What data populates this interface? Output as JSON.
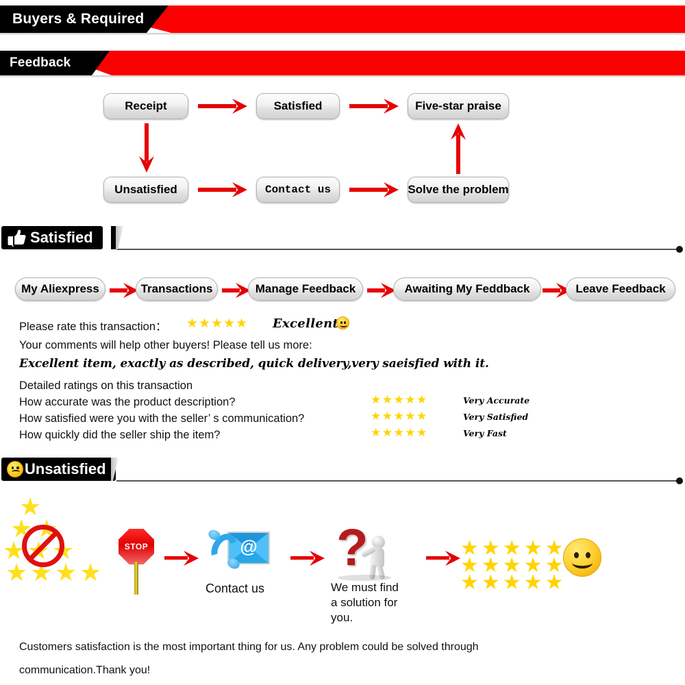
{
  "banners": [
    {
      "id": "buyers",
      "label": "Buyers & Required"
    },
    {
      "id": "feedback",
      "label": "Feedback"
    }
  ],
  "flowchart": {
    "nodes": [
      {
        "id": "receipt",
        "label": "Receipt"
      },
      {
        "id": "satisfied",
        "label": "Satisfied"
      },
      {
        "id": "five-star-praise",
        "label": "Five-star praise"
      },
      {
        "id": "unsatisfied",
        "label": "Unsatisfied"
      },
      {
        "id": "contact-us",
        "label": "Contact us"
      },
      {
        "id": "solve-the-problem",
        "label": "Solve the problem"
      }
    ]
  },
  "satisfied_section": {
    "title": "Satisfied",
    "icon": "thumbs-up-icon",
    "breadcrumbs": [
      {
        "label": "My Aliexpress"
      },
      {
        "label": "Transactions"
      },
      {
        "label": "Manage Feedback"
      },
      {
        "label": "Awaiting My Feddback"
      },
      {
        "label": "Leave Feedback"
      }
    ],
    "rate_prompt": "Please rate this transaction：",
    "rate_stars": "★★★★★",
    "rate_word": "Excellent",
    "rate_emoji": "smiley-face-icon",
    "comments_prompt": "Your comments will help other buyers! Please tell us more:",
    "comment_text": "Excellent item, exactly as described, quick delivery,very saeisfied with it.",
    "detailed_heading": "Detailed ratings on this transaction",
    "detailed_rows": [
      {
        "question": "How accurate was the product description?",
        "stars": "★★★★★",
        "verdict": "Very Accurate"
      },
      {
        "question": "How satisfied were you with the seller’ s communication?",
        "stars": "★★★★★",
        "verdict": "Very Satisfied"
      },
      {
        "question": "How quickly did the seller ship the item?",
        "stars": "★★★★★",
        "verdict": "Very Fast"
      }
    ]
  },
  "unsatisfied_section": {
    "title": "Unsatisfied",
    "icon": "sad-face-icon",
    "steps": [
      {
        "id": "no-bad-rating",
        "icon": "stars-prohibited-icon",
        "caption": ""
      },
      {
        "id": "stop",
        "icon": "stop-sign-icon",
        "label": "STOP",
        "caption": ""
      },
      {
        "id": "contact",
        "icon": "phone-email-icon",
        "caption": "Contact us"
      },
      {
        "id": "solution",
        "icon": "question-mark-person-icon",
        "caption": "We must find\na solution for\nyou."
      },
      {
        "id": "five-stars",
        "icon": "five-star-grid-icon",
        "caption": ""
      },
      {
        "id": "happy",
        "icon": "smiley-face-icon",
        "caption": ""
      }
    ],
    "caption_contact": "Contact us",
    "caption_solution_l1": "We must find",
    "caption_solution_l2": "a solution for",
    "caption_solution_l3": "you.",
    "star_grid_rows": [
      "★★★★★",
      "★★★★★",
      "★★★★★"
    ]
  },
  "footer": {
    "line1": "Customers satisfaction is the most important thing for us. Any problem could be solved through",
    "line2": "communication.Thank you!"
  },
  "colors": {
    "red": "#fa0000",
    "arrow_red": "#e60000",
    "star_yellow": "#ffd400",
    "black": "#000000",
    "pill_border": "#b4b4b4"
  }
}
